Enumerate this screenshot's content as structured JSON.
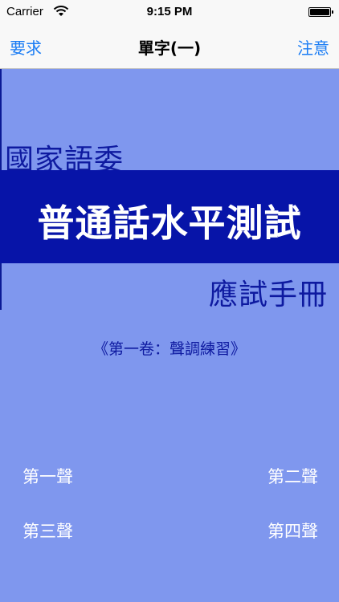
{
  "status_bar": {
    "carrier": "Carrier",
    "time": "9:15 PM",
    "wifi_icon": "wifi-icon",
    "battery_icon": "battery-icon"
  },
  "nav": {
    "left_label": "要求",
    "title": "單字(一)",
    "right_label": "注意"
  },
  "content": {
    "org": "國家語委",
    "title": "普通話水平測試",
    "subtitle": "應試手冊",
    "volume": "《第一卷：聲調練習》"
  },
  "tones": [
    {
      "label": "第一聲"
    },
    {
      "label": "第二聲"
    },
    {
      "label": "第三聲"
    },
    {
      "label": "第四聲"
    }
  ],
  "colors": {
    "background": "#7f97ee",
    "band": "#0714a8",
    "accent": "#1a7cf4",
    "text_dark_blue": "#0e1aa0"
  }
}
